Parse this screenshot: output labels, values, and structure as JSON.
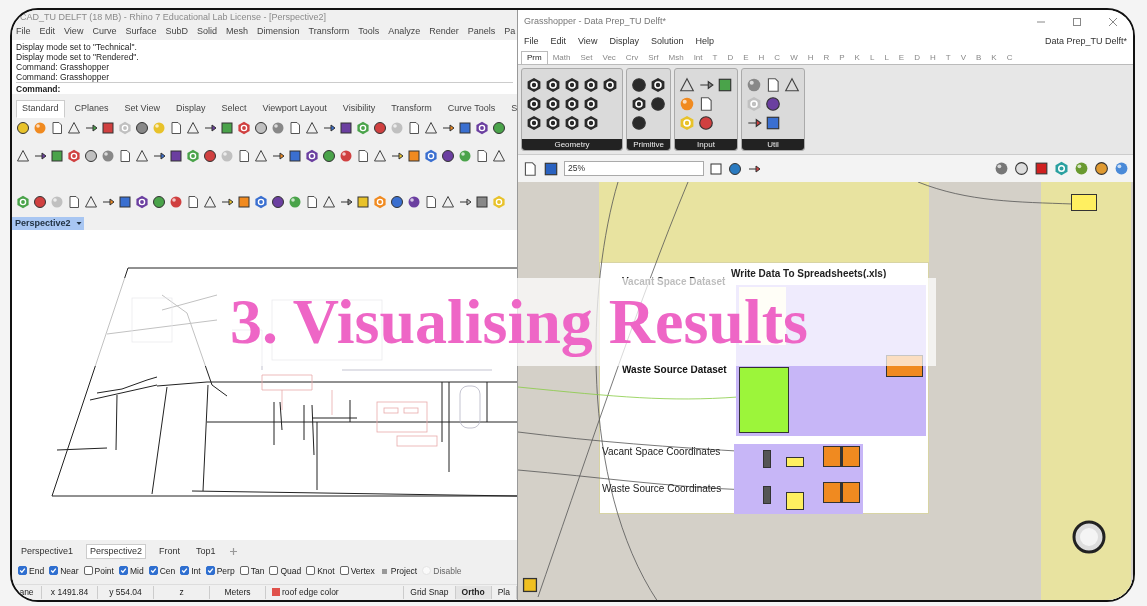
{
  "rhino": {
    "title": "CAD_TU DELFT (18 MB) - Rhino 7 Educational Lab License - [Perspective2]",
    "menu": [
      "File",
      "Edit",
      "View",
      "Curve",
      "Surface",
      "SubD",
      "Solid",
      "Mesh",
      "Dimension",
      "Transform",
      "Tools",
      "Analyze",
      "Render",
      "Panels",
      "Pa"
    ],
    "command_history": [
      "Display mode set to \"Technical\".",
      "Display mode set to \"Rendered\".",
      "Command: Grasshopper",
      "Command: Grasshopper"
    ],
    "command_prompt": "Command:",
    "toolbar_tabs": [
      {
        "label": "Standard",
        "selected": true
      },
      {
        "label": "CPlanes",
        "selected": false
      },
      {
        "label": "Set View",
        "selected": false
      },
      {
        "label": "Display",
        "selected": false
      },
      {
        "label": "Select",
        "selected": false
      },
      {
        "label": "Viewport Layout",
        "selected": false
      },
      {
        "label": "Visibility",
        "selected": false
      },
      {
        "label": "Transform",
        "selected": false
      },
      {
        "label": "Curve Tools",
        "selected": false
      },
      {
        "label": "S",
        "selected": false
      }
    ],
    "viewport": {
      "title": "Perspective2"
    },
    "viewport_tabs": [
      {
        "label": "Perspective1",
        "selected": false
      },
      {
        "label": "Perspective2",
        "selected": true
      },
      {
        "label": "Front",
        "selected": false
      },
      {
        "label": "Top1",
        "selected": false
      }
    ],
    "osnaps": [
      {
        "kind": "check",
        "label": "End",
        "checked": true
      },
      {
        "kind": "check",
        "label": "Near",
        "checked": true
      },
      {
        "kind": "check",
        "label": "Point",
        "checked": false
      },
      {
        "kind": "check",
        "label": "Mid",
        "checked": true
      },
      {
        "kind": "check",
        "label": "Cen",
        "checked": true
      },
      {
        "kind": "check",
        "label": "Int",
        "checked": true
      },
      {
        "kind": "check",
        "label": "Perp",
        "checked": true
      },
      {
        "kind": "check",
        "label": "Tan",
        "checked": false
      },
      {
        "kind": "check",
        "label": "Quad",
        "checked": false
      },
      {
        "kind": "check",
        "label": "Knot",
        "checked": false
      },
      {
        "kind": "check",
        "label": "Vertex",
        "checked": false
      },
      {
        "kind": "marker",
        "label": "Project"
      },
      {
        "kind": "faint",
        "label": "Disable",
        "checked": false
      }
    ],
    "status_bar": [
      {
        "kind": "pane",
        "text": "ane"
      },
      {
        "kind": "pane",
        "text": "x 1491.84"
      },
      {
        "kind": "pane",
        "text": "y 554.04"
      },
      {
        "kind": "pane",
        "text": "z"
      },
      {
        "kind": "pane",
        "text": "Meters"
      },
      {
        "kind": "layer",
        "text": "roof edge color",
        "color": "#e0514b"
      },
      {
        "kind": "toggle",
        "text": "Grid Snap",
        "on": false
      },
      {
        "kind": "toggle",
        "text": "Ortho",
        "on": true
      },
      {
        "kind": "toggle",
        "text": "Pla",
        "on": false
      }
    ]
  },
  "grasshopper": {
    "title": "Grasshopper - Data Prep_TU Delft*",
    "menu": [
      "File",
      "Edit",
      "View",
      "Display",
      "Solution",
      "Help"
    ],
    "document": "Data Prep_TU Delft*",
    "tabs": [
      {
        "label": "Prm",
        "selected": true
      },
      {
        "label": "Math",
        "selected": false
      },
      {
        "label": "Set",
        "selected": false
      },
      {
        "label": "Vec",
        "selected": false
      },
      {
        "label": "Crv",
        "selected": false
      },
      {
        "label": "Srf",
        "selected": false
      },
      {
        "label": "Msh",
        "selected": false
      },
      {
        "label": "Int",
        "selected": false
      },
      {
        "label": "T",
        "selected": false
      },
      {
        "label": "D",
        "selected": false
      },
      {
        "label": "E",
        "selected": false
      },
      {
        "label": "H",
        "selected": false
      },
      {
        "label": "C",
        "selected": false
      },
      {
        "label": "W",
        "selected": false
      },
      {
        "label": "H",
        "selected": false
      },
      {
        "label": "R",
        "selected": false
      },
      {
        "label": "P",
        "selected": false
      },
      {
        "label": "K",
        "selected": false
      },
      {
        "label": "L",
        "selected": false
      },
      {
        "label": "L",
        "selected": false
      },
      {
        "label": "E",
        "selected": false
      },
      {
        "label": "D",
        "selected": false
      },
      {
        "label": "H",
        "selected": false
      },
      {
        "label": "T",
        "selected": false
      },
      {
        "label": "V",
        "selected": false
      },
      {
        "label": "B",
        "selected": false
      },
      {
        "label": "K",
        "selected": false
      },
      {
        "label": "C",
        "selected": false
      }
    ],
    "panels": [
      {
        "label": "Geometry"
      },
      {
        "label": "Primitive"
      },
      {
        "label": "Input"
      },
      {
        "label": "Util"
      }
    ],
    "zoom": "25%",
    "canvas": {
      "group_title": "Write Data To Spreadsheets(.xls)",
      "labels": [
        "Vacant Space Dataset",
        "Waste Source Dataset",
        "Vacant Space Coordinates",
        "Waste Source Coordinates"
      ]
    }
  },
  "overlay_title": "3. Visualising Results"
}
